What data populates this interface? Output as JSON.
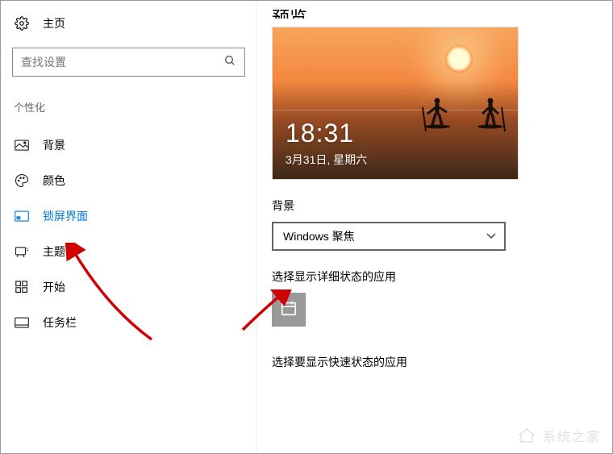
{
  "sidebar": {
    "home_label": "主页",
    "search_placeholder": "查找设置",
    "category_label": "个性化",
    "items": [
      {
        "label": "背景"
      },
      {
        "label": "颜色"
      },
      {
        "label": "锁屏界面"
      },
      {
        "label": "主题"
      },
      {
        "label": "开始"
      },
      {
        "label": "任务栏"
      }
    ]
  },
  "main": {
    "page_title": "预览",
    "preview": {
      "time": "18:31",
      "date": "3月31日, 星期六"
    },
    "background_label": "背景",
    "background_dropdown": "Windows 聚焦",
    "detailed_status_label": "选择显示详细状态的应用",
    "quick_status_label": "选择要显示快速状态的应用"
  },
  "watermark": "系统之家"
}
